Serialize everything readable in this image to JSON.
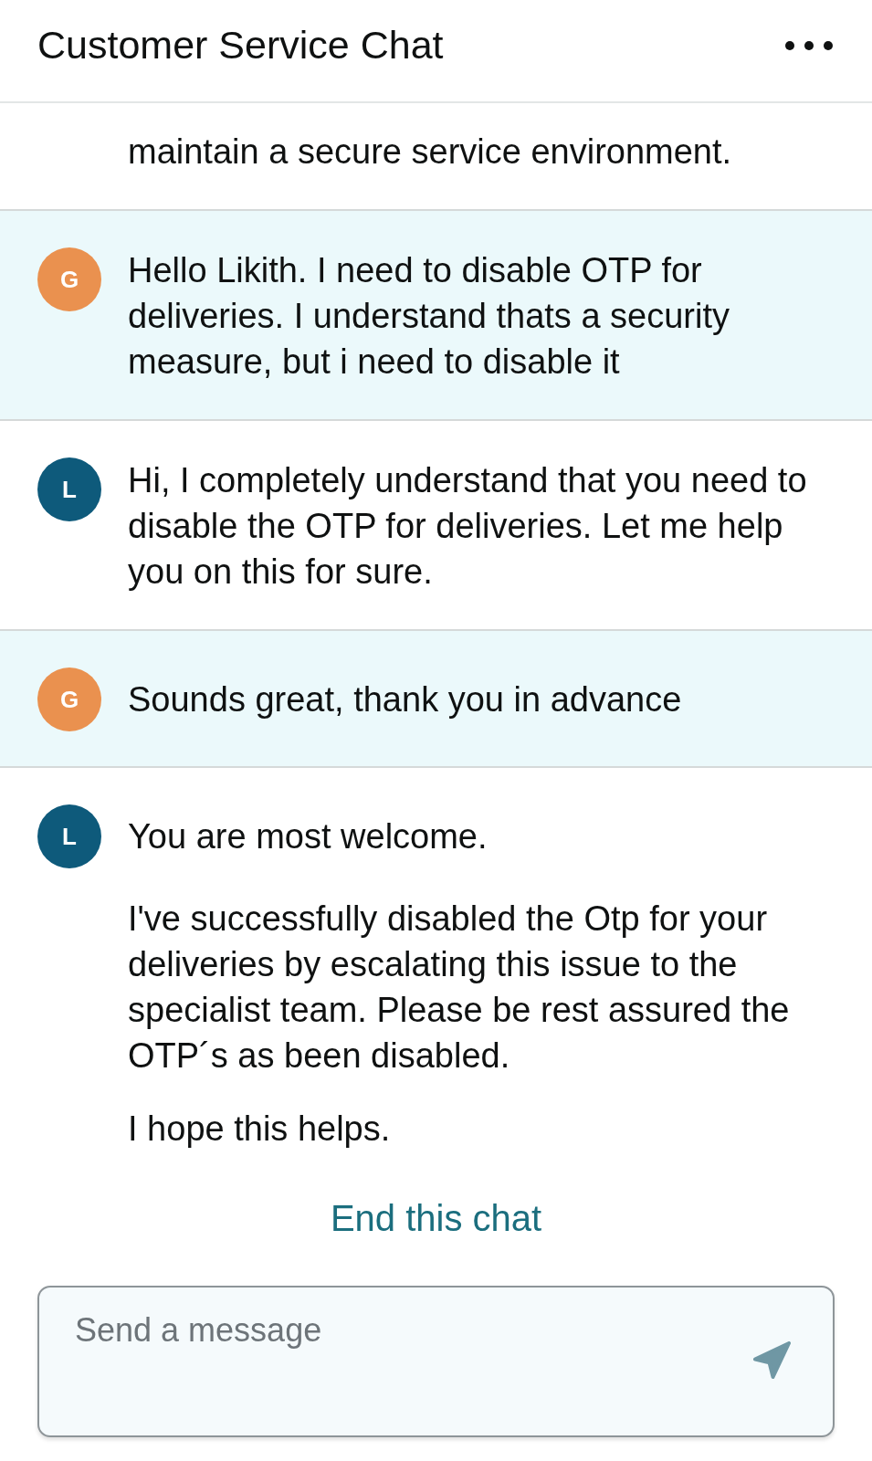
{
  "header": {
    "title": "Customer Service Chat"
  },
  "messages": [
    {
      "kind": "agent",
      "paragraphs": [
        "maintain a secure service environment."
      ]
    },
    {
      "kind": "customer",
      "avatar": "G",
      "paragraphs": [
        "Hello Likith. I need to disable OTP for deliveries. I understand thats a security measure, but i need to disable it"
      ]
    },
    {
      "kind": "agent",
      "avatar": "L",
      "paragraphs": [
        "Hi, I completely understand that you need to disable the OTP for deliveries. Let me help you on this for sure."
      ]
    },
    {
      "kind": "customer",
      "avatar": "G",
      "paragraphs": [
        "Sounds great, thank you in advance"
      ]
    },
    {
      "kind": "agent",
      "avatar": "L",
      "paragraphs": [
        "You are most welcome.",
        "I've successfully disabled the Otp for your deliveries by escalating this issue to the specialist team. Please be rest assured the OTP´s as been disabled.",
        "I hope this helps."
      ]
    }
  ],
  "end_chat_link": "End this chat",
  "composer": {
    "placeholder": "Send a message"
  }
}
